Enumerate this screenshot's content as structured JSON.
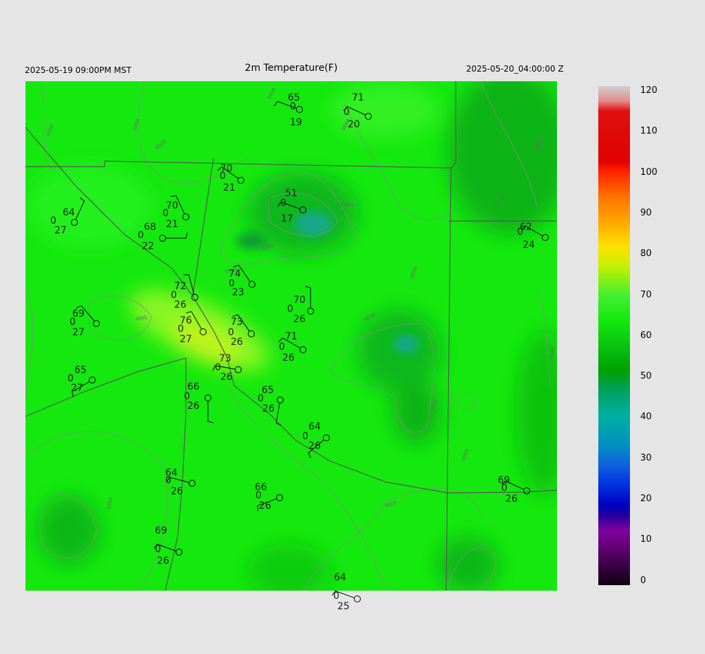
{
  "header": {
    "left_time": "2025-05-19 09:00PM MST",
    "title": "2m Temperature(F)",
    "right_time": "2025-05-20_04:00:00 Z"
  },
  "colorbar": {
    "labels": [
      "120",
      "110",
      "100",
      "90",
      "80",
      "70",
      "60",
      "50",
      "40",
      "30",
      "20",
      "10",
      "0"
    ]
  },
  "contour_labels": [
    "5000",
    "5000",
    "6000",
    "6000",
    "5000",
    "5000",
    "5000",
    "4000",
    "4000",
    "4000",
    "4000",
    "4000",
    "4000",
    "4000",
    "4000",
    "4000",
    "5000",
    "4000"
  ],
  "stations": [
    {
      "t": "65",
      "d": "0",
      "w": "19"
    },
    {
      "t": "71",
      "d": "0",
      "w": "20"
    },
    {
      "t": "70",
      "d": "0",
      "w": "21"
    },
    {
      "t": "51",
      "d": "0",
      "w": "17"
    },
    {
      "t": "64",
      "d": "0",
      "w": "27"
    },
    {
      "t": "70",
      "d": "0",
      "w": "21"
    },
    {
      "t": "68",
      "d": "0",
      "w": "22"
    },
    {
      "t": "62",
      "d": "0",
      "w": "24"
    },
    {
      "t": "74",
      "d": "0",
      "w": "23"
    },
    {
      "t": "72",
      "d": "0",
      "w": "26"
    },
    {
      "t": "70",
      "d": "0",
      "w": "26"
    },
    {
      "t": "69",
      "d": "0",
      "w": "27"
    },
    {
      "t": "76",
      "d": "0",
      "w": "27"
    },
    {
      "t": "73",
      "d": "0",
      "w": "26"
    },
    {
      "t": "71",
      "d": "0",
      "w": "26"
    },
    {
      "t": "73",
      "d": "0",
      "w": "26"
    },
    {
      "t": "65",
      "d": "0",
      "w": "27"
    },
    {
      "t": "66",
      "d": "0",
      "w": "26"
    },
    {
      "t": "65",
      "d": "0",
      "w": "26"
    },
    {
      "t": "64",
      "d": "0",
      "w": "26"
    },
    {
      "t": "64",
      "d": "0",
      "w": "26"
    },
    {
      "t": "69",
      "d": "0",
      "w": "26"
    },
    {
      "t": "66",
      "d": "0",
      "w": "26"
    },
    {
      "t": "69",
      "d": "0",
      "w": "26"
    },
    {
      "t": "64",
      "d": "0",
      "w": "25"
    }
  ]
}
